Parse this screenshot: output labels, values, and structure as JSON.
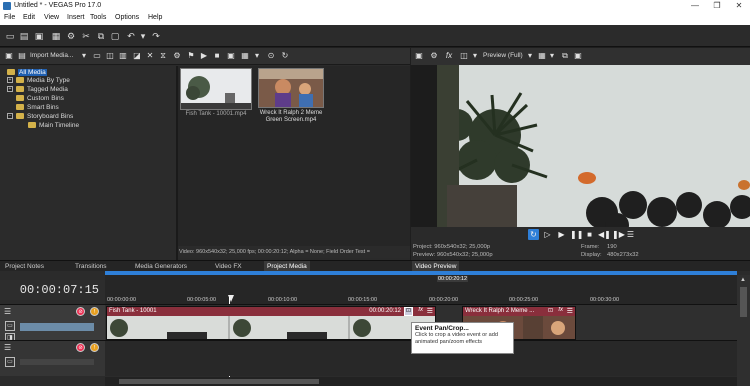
{
  "window": {
    "title": "Untitled * - VEGAS Pro 17.0"
  },
  "menu": [
    "File",
    "Edit",
    "View",
    "Insert",
    "Tools",
    "Options",
    "Help"
  ],
  "explorer": {
    "import_label": "Import Media...",
    "tree": [
      "All Media",
      "Media By Type",
      "Tagged Media",
      "Custom Bins",
      "Smart Bins",
      "Storyboard Bins",
      "Main Timeline"
    ],
    "media": [
      {
        "caption": "Fish Tank - 10001.mp4"
      },
      {
        "caption": "Wreck It Ralph 2 Meme Green Screen.mp4"
      }
    ],
    "info": "Video: 960x540x32; 25,000 fps; 00:00:20:12; Alpha = None; Field Order Test ="
  },
  "preview": {
    "toolbar_label": "Preview (Full)",
    "project_line": "Project:   960x540x32; 25,000p",
    "preview_line": "Preview:  960x540x32; 25,000p",
    "frame_label": "Frame:",
    "frame_value": "190",
    "display_label": "Display:",
    "display_value": "480x273x32"
  },
  "tabs": [
    "Project Notes",
    "Transitions",
    "Media Generators",
    "Video FX",
    "Project Media",
    "Video Preview"
  ],
  "timeline": {
    "timecode": "00:00:07:15",
    "ruler_marks": [
      "00:00:00:00",
      "00:00:05:00",
      "00:00:10:00",
      "00:00:15:00",
      "00:00:20:00",
      "00:00:25:00",
      "00:00:30:00"
    ],
    "marker_label": "00:00:20:12",
    "events": [
      {
        "title": "Fish Tank - 10001",
        "end_time": "00:00:20:12"
      },
      {
        "title": "Wreck It Ralph 2 Meme ..."
      }
    ]
  },
  "tooltip": {
    "title": "Event Pan/Crop...",
    "body": "Click to crop a video event or add animated pan/zoom effects"
  },
  "colors": {
    "event_header": "#8a2f3c",
    "track_bg": "#2f2f2f",
    "accent_blue": "#2e7fd8"
  }
}
